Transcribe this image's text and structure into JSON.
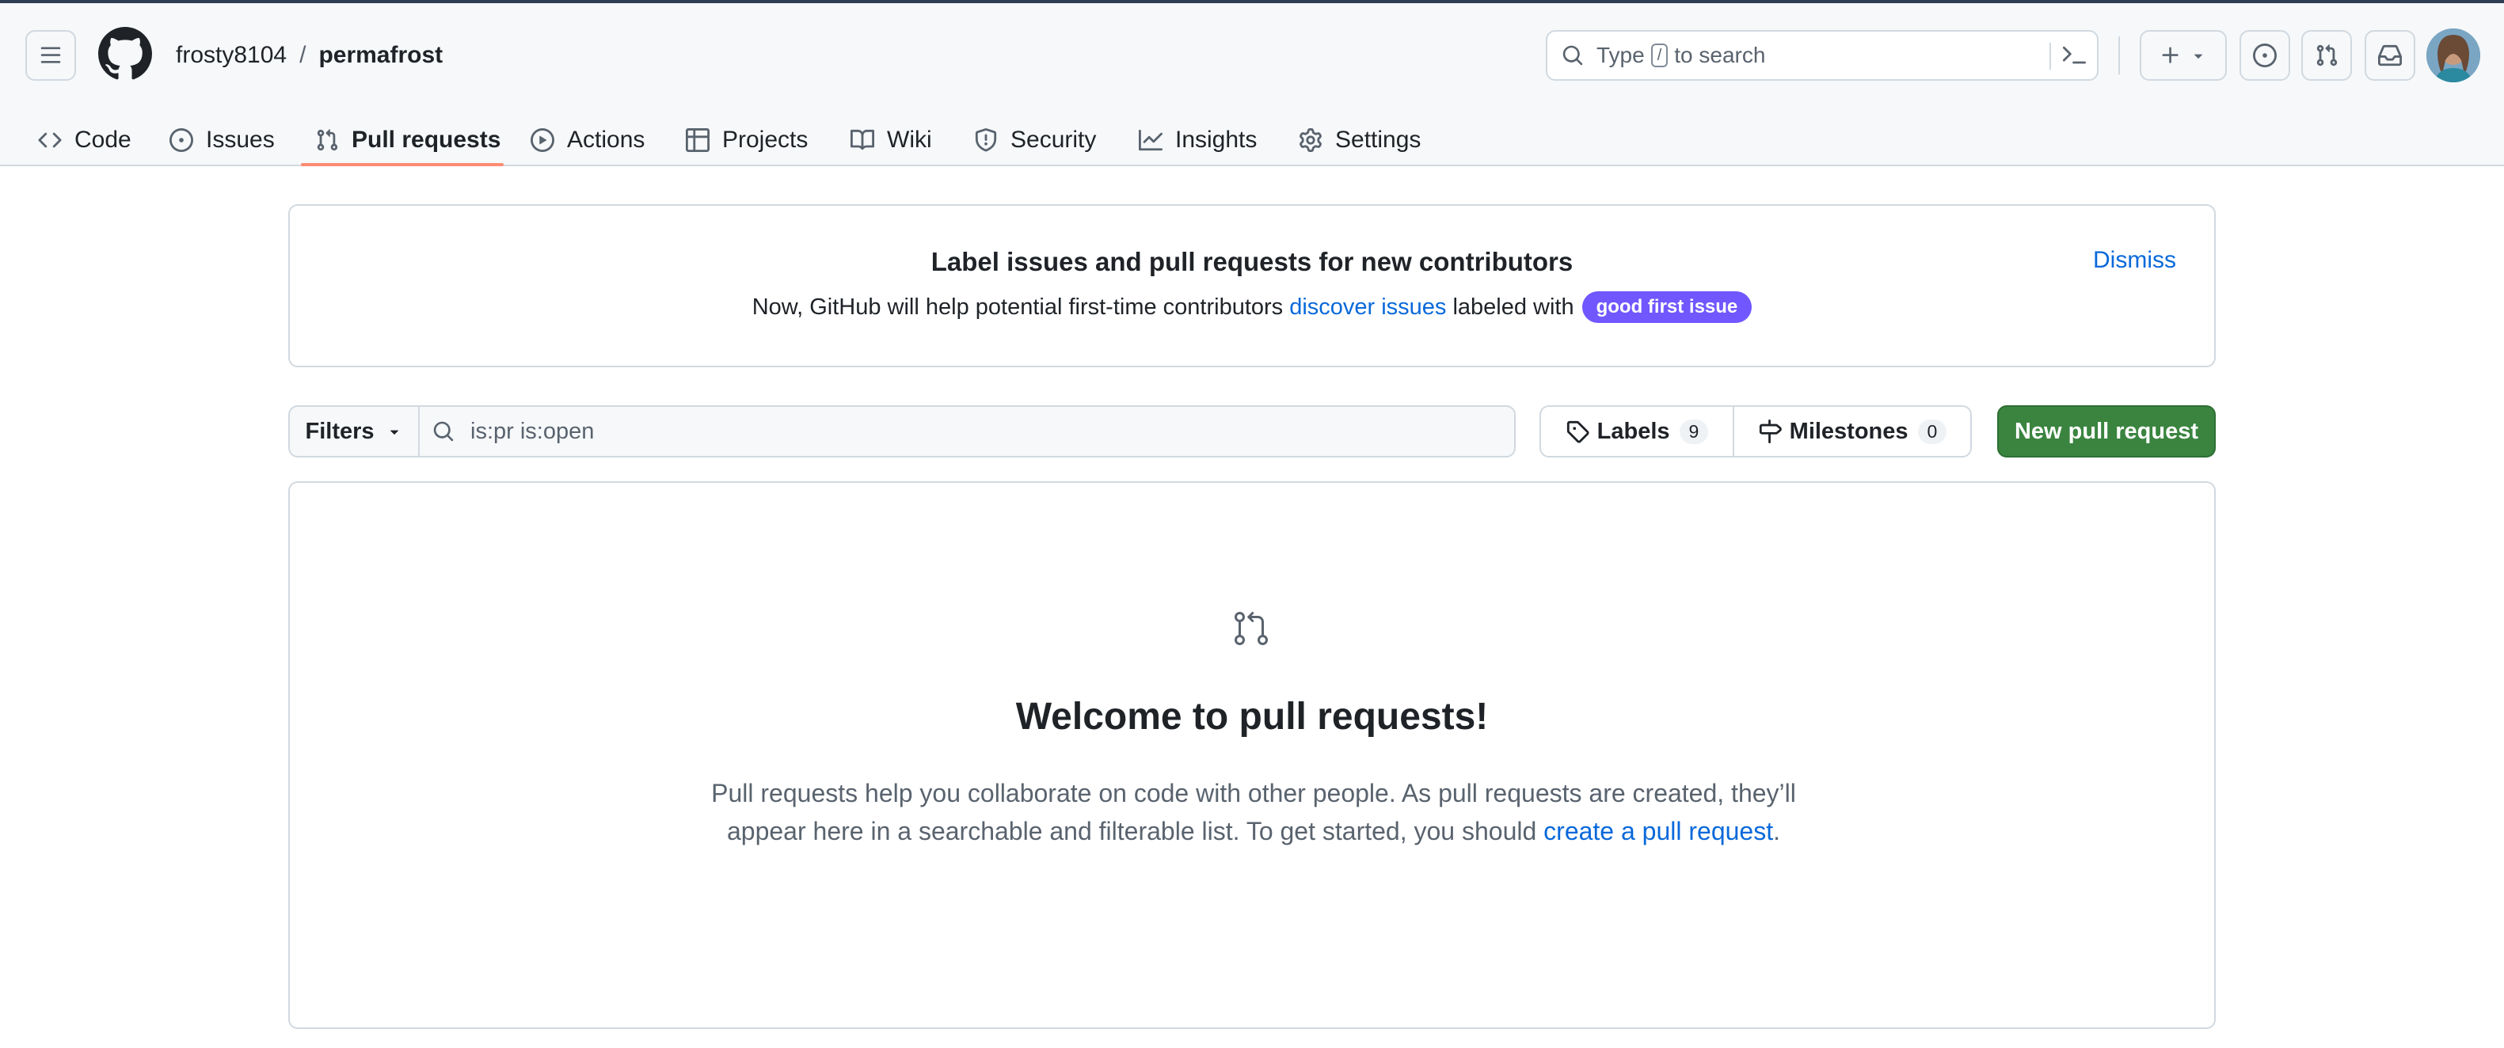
{
  "header": {
    "owner": "frosty8104",
    "separator": "/",
    "repo": "permafrost",
    "search_prefix": "Type",
    "search_key": "/",
    "search_suffix": "to search"
  },
  "tabs": [
    {
      "label": "Code",
      "icon": "code-icon"
    },
    {
      "label": "Issues",
      "icon": "issue-opened-icon"
    },
    {
      "label": "Pull requests",
      "icon": "git-pull-request-icon",
      "active": true
    },
    {
      "label": "Actions",
      "icon": "play-icon"
    },
    {
      "label": "Projects",
      "icon": "table-icon"
    },
    {
      "label": "Wiki",
      "icon": "book-icon"
    },
    {
      "label": "Security",
      "icon": "shield-icon"
    },
    {
      "label": "Insights",
      "icon": "graph-icon"
    },
    {
      "label": "Settings",
      "icon": "gear-icon"
    }
  ],
  "banner": {
    "title": "Label issues and pull requests for new contributors",
    "text_before": "Now, GitHub will help potential first-time contributors",
    "link": "discover issues",
    "text_after": "labeled with",
    "label_chip": "good first issue",
    "dismiss": "Dismiss",
    "chip_color": "#7057ff"
  },
  "toolbar": {
    "filters_label": "Filters",
    "filter_value": "is:pr is:open",
    "labels_label": "Labels",
    "labels_count": "9",
    "milestones_label": "Milestones",
    "milestones_count": "0",
    "new_pr_label": "New pull request",
    "new_pr_color": "#3a843f"
  },
  "blankslate": {
    "heading": "Welcome to pull requests!",
    "desc_before": "Pull requests help you collaborate on code with other people. As pull requests are created, they’ll appear here in a searchable and filterable list. To get started, you should",
    "desc_link": "create a pull request",
    "desc_after": "."
  },
  "colors": {
    "link": "#0969da",
    "active_tab_underline": "#fd8c73"
  }
}
